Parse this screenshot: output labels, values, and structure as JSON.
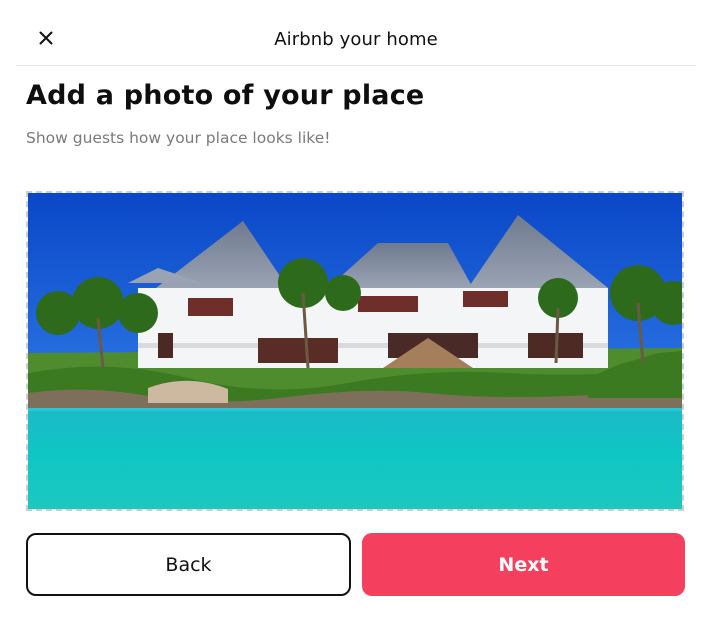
{
  "header": {
    "title": "Airbnb your home",
    "close_icon": "close-icon"
  },
  "main": {
    "title": "Add a photo of your place",
    "subtitle": "Show guests how your place looks like!"
  },
  "photo": {
    "subject": "beachfront-villa-photo"
  },
  "footer": {
    "back_label": "Back",
    "next_label": "Next"
  },
  "colors": {
    "accent": "#f43f5e",
    "text": "#111111",
    "muted": "#7a7a7a",
    "border": "#c9ced4"
  }
}
